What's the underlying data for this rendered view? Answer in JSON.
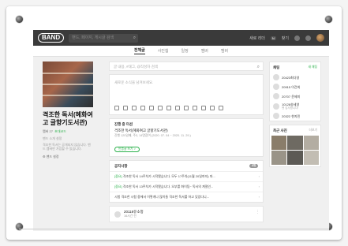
{
  "topbar": {
    "logo": "BAND",
    "search_placeholder": "밴드, 페이지, 게시글 검색",
    "right_items": [
      "새로 리더",
      "찾기"
    ],
    "badge": "N"
  },
  "nav": {
    "tabs": [
      "전체글",
      "사진첩",
      "일정",
      "멤버",
      "멤버"
    ]
  },
  "left": {
    "band_title": "격조한 독서(혜화여고 글향기도서관)",
    "member_label": "멤버 27",
    "invite_label": "초대코드",
    "intro_label": "밴드 소개 설정",
    "intro_text": "격조한 독서는 공개되지 않습니다. 밴드 멤버만 가입할 수 있습니다.",
    "settings_label": "밴드 설정"
  },
  "mid": {
    "search_placeholder": "글 내용, #태그, @작성자 검색",
    "composer_placeholder": "새로운 소식을 남겨보세요.",
    "mission_heading": "진행 중 미션",
    "mission_title": "격조한 독서(혜화여고 글향기도서관)",
    "mission_sub": "진행 120일째, 주3, 14명참여 (2020. 07. 04 ~ 2020. 11. 29.)",
    "mission_button": "인증글 쓰기 >",
    "notice_heading": "공지사항",
    "notice_more": "3개",
    "notices": [
      {
        "tag": "[중요]",
        "text": "격조한 독서 14주차가 시작됐습니다. 모두 17주차(11월 20일까지) 마..."
      },
      {
        "tag": "[중요]",
        "text": "격조한 독서 13주차가 시작됐습니다. 오부를 화이팅~ 독서의 계절인..."
      },
      {
        "tag": "",
        "text": "시험 격조한 시험 중에서 이렇게나 많이들 격조한 독서를 하고 있었다니..."
      }
    ],
    "post_author": "20118유소정",
    "post_time": "16시간 전"
  },
  "right": {
    "chat_heading": "채팅",
    "chat_link": "새 채팅",
    "chats": [
      {
        "name": "20423최다영",
        "sub": ""
      },
      {
        "name": "20915 이건희",
        "sub": ""
      },
      {
        "name": "20707 윤제미",
        "sub": ""
      },
      {
        "name": "10128송세영",
        "sub": "밴 감사합니다!"
      },
      {
        "name": "20322 한지민",
        "sub": ""
      }
    ],
    "photos_heading": "최근 사진",
    "photos_link": "더보기"
  }
}
